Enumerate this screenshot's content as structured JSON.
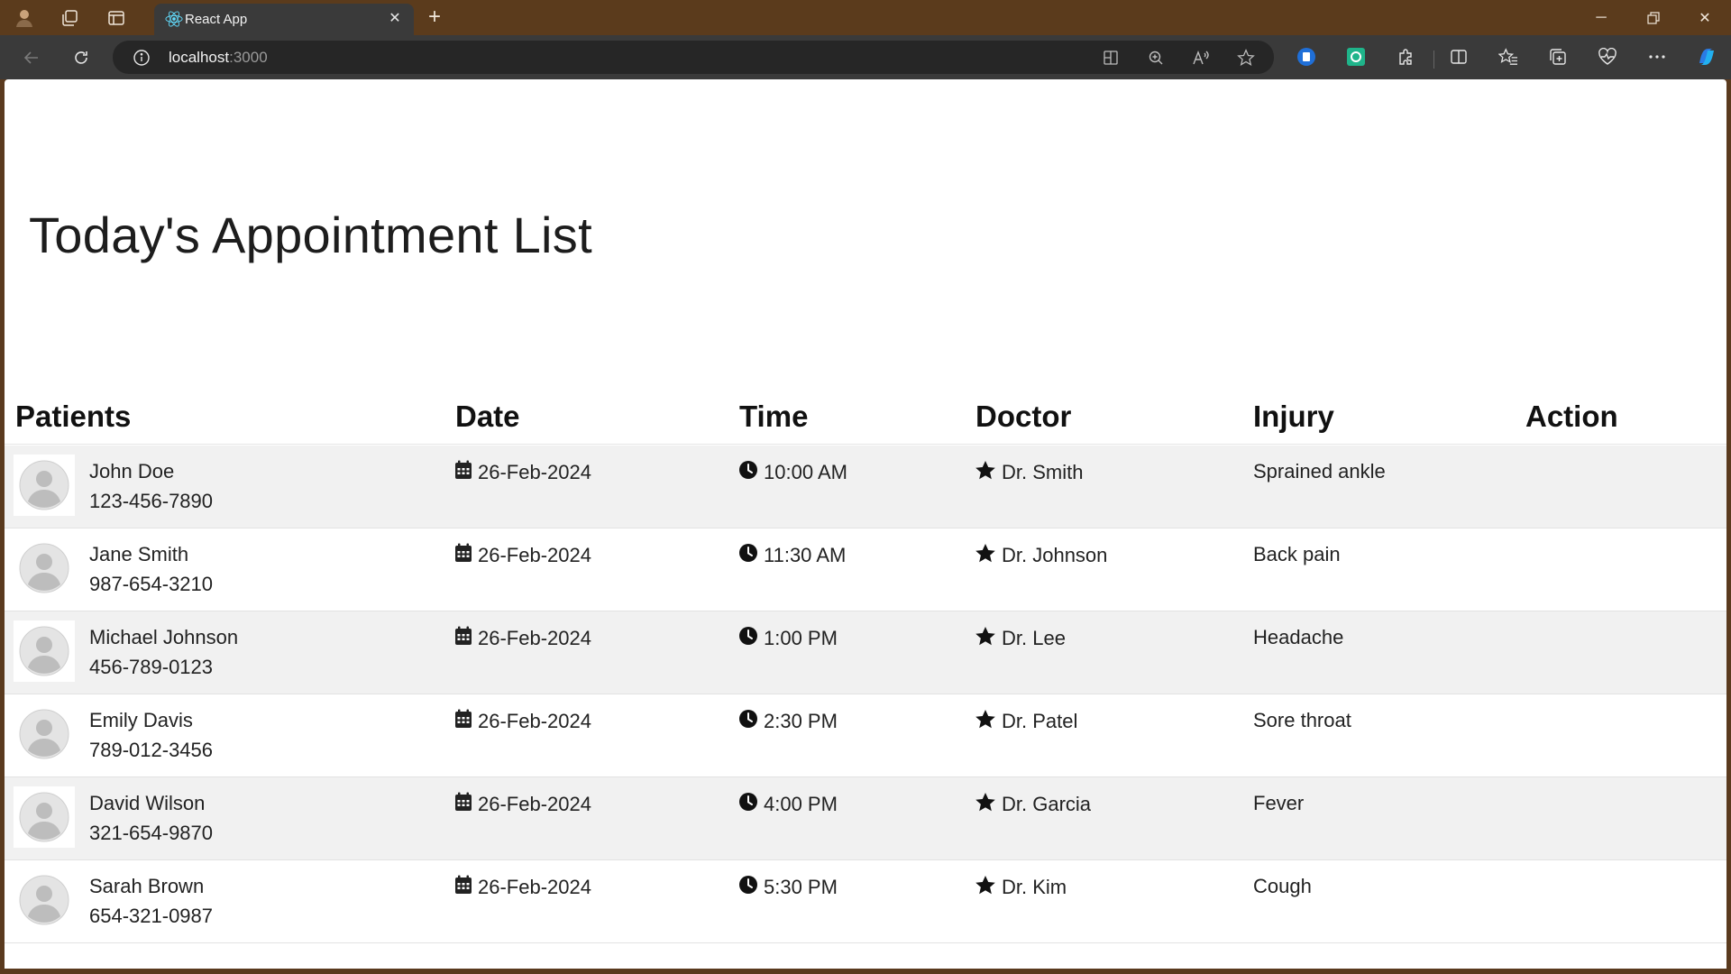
{
  "browser": {
    "tab_title": "React App",
    "url_host": "localhost",
    "url_port": ":3000"
  },
  "page": {
    "title": "Today's Appointment List"
  },
  "table": {
    "headers": {
      "patients": "Patients",
      "date": "Date",
      "time": "Time",
      "doctor": "Doctor",
      "injury": "Injury",
      "action": "Action"
    },
    "rows": [
      {
        "name": "John Doe",
        "phone": "123-456-7890",
        "date": "26-Feb-2024",
        "time": "10:00 AM",
        "doctor": "Dr. Smith",
        "injury": "Sprained ankle"
      },
      {
        "name": "Jane Smith",
        "phone": "987-654-3210",
        "date": "26-Feb-2024",
        "time": "11:30 AM",
        "doctor": "Dr. Johnson",
        "injury": "Back pain"
      },
      {
        "name": "Michael Johnson",
        "phone": "456-789-0123",
        "date": "26-Feb-2024",
        "time": "1:00 PM",
        "doctor": "Dr. Lee",
        "injury": "Headache"
      },
      {
        "name": "Emily Davis",
        "phone": "789-012-3456",
        "date": "26-Feb-2024",
        "time": "2:30 PM",
        "doctor": "Dr. Patel",
        "injury": "Sore throat"
      },
      {
        "name": "David Wilson",
        "phone": "321-654-9870",
        "date": "26-Feb-2024",
        "time": "4:00 PM",
        "doctor": "Dr. Garcia",
        "injury": "Fever"
      },
      {
        "name": "Sarah Brown",
        "phone": "654-321-0987",
        "date": "26-Feb-2024",
        "time": "5:30 PM",
        "doctor": "Dr. Kim",
        "injury": "Cough"
      }
    ]
  },
  "icons": {
    "date": "calendar-icon",
    "time": "clock-icon",
    "doctor": "star-icon",
    "avatar": "user-avatar-icon"
  },
  "colors": {
    "titlebar": "#5b3b1c",
    "toolbar": "#3a3a3a",
    "row_odd": "#f1f1f1",
    "row_even": "#ffffff"
  }
}
